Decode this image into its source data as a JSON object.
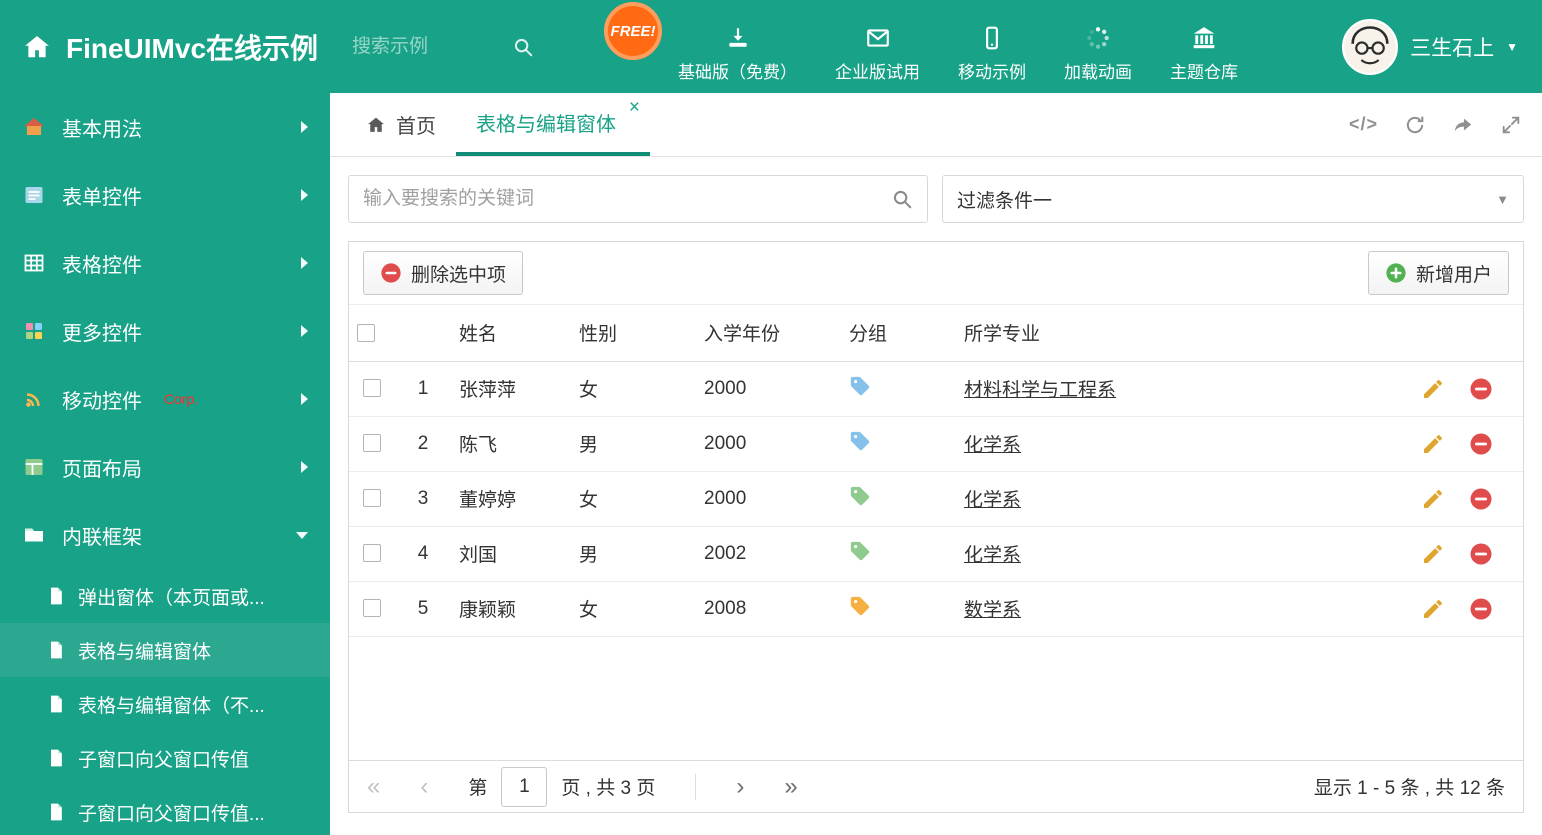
{
  "colors": {
    "primary": "#18A287",
    "primary_dark": "#0F8C76",
    "sidebar_selected": "#2CA890",
    "free_badge_bg": "#FF6A13",
    "tag_blue": "#85C1E9",
    "tag_green": "#8FCB8F",
    "tag_orange": "#F5B041",
    "edit_icon": "#DFA62F",
    "delete_icon": "#E04B4B",
    "add_icon": "#52B152"
  },
  "icons": {
    "close": "×",
    "caret_down": "▼",
    "code": "</>",
    "first_page": "«",
    "prev_page": "‹",
    "next_page": "›",
    "last_page": "»"
  },
  "header": {
    "title": "FineUIMvc在线示例",
    "search_placeholder": "搜索示例",
    "free_badge": "FREE!",
    "nav": [
      {
        "label": "基础版（免费）"
      },
      {
        "label": "企业版试用"
      },
      {
        "label": "移动示例"
      },
      {
        "label": "加载动画"
      },
      {
        "label": "主题仓库"
      }
    ],
    "user_name": "三生石上"
  },
  "sidebar": {
    "items": [
      {
        "label": "基本用法"
      },
      {
        "label": "表单控件"
      },
      {
        "label": "表格控件"
      },
      {
        "label": "更多控件"
      },
      {
        "label": "移动控件",
        "badge": "Corp."
      },
      {
        "label": "页面布局"
      },
      {
        "label": "内联框架"
      }
    ],
    "subitems": [
      {
        "label": "弹出窗体（本页面或..."
      },
      {
        "label": "表格与编辑窗体"
      },
      {
        "label": "表格与编辑窗体（不..."
      },
      {
        "label": "子窗口向父窗口传值"
      },
      {
        "label": "子窗口向父窗口传值..."
      }
    ]
  },
  "tabs": {
    "home": "首页",
    "active": "表格与编辑窗体"
  },
  "content": {
    "search_placeholder": "输入要搜索的关键词",
    "filter_value": "过滤条件一",
    "toolbar": {
      "delete_label": "删除选中项",
      "add_label": "新增用户"
    },
    "table": {
      "headers": {
        "name": "姓名",
        "gender": "性别",
        "year": "入学年份",
        "group": "分组",
        "major": "所学专业"
      },
      "rows": [
        {
          "index": "1",
          "name": "张萍萍",
          "gender": "女",
          "year": "2000",
          "tag_color": "#85C1E9",
          "major": "材料科学与工程系"
        },
        {
          "index": "2",
          "name": "陈飞",
          "gender": "男",
          "year": "2000",
          "tag_color": "#85C1E9",
          "major": "化学系"
        },
        {
          "index": "3",
          "name": "董婷婷",
          "gender": "女",
          "year": "2000",
          "tag_color": "#8FCB8F",
          "major": "化学系"
        },
        {
          "index": "4",
          "name": "刘国",
          "gender": "男",
          "year": "2002",
          "tag_color": "#8FCB8F",
          "major": "化学系"
        },
        {
          "index": "5",
          "name": "康颖颖",
          "gender": "女",
          "year": "2008",
          "tag_color": "#F5B041",
          "major": "数学系"
        }
      ]
    },
    "pagination": {
      "page_prefix": "第",
      "current_page": "1",
      "page_suffix": "页 , 共 3 页",
      "summary": "显示 1 - 5 条 , 共 12 条"
    }
  }
}
